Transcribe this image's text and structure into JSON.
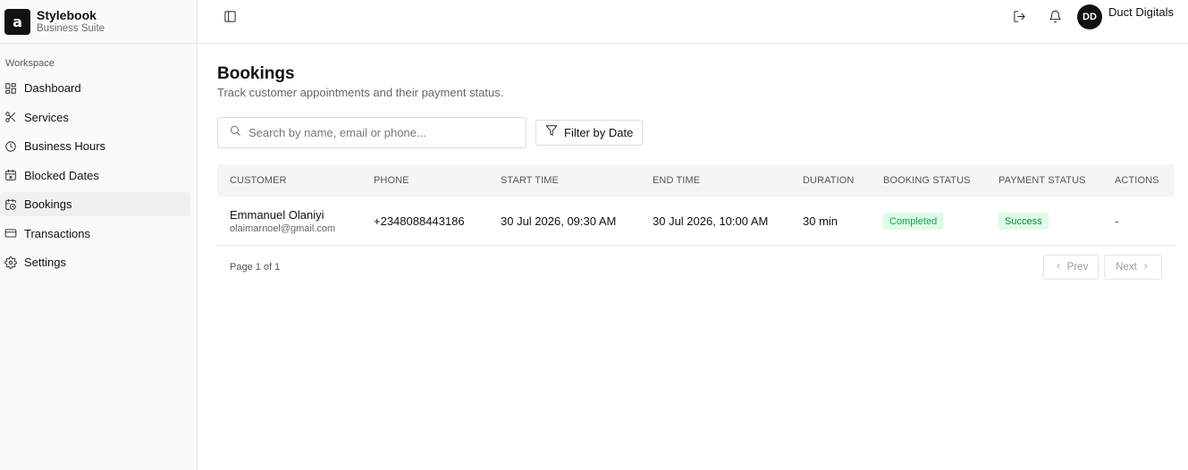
{
  "brand": {
    "logo": "a",
    "name": "Stylebook",
    "subtitle": "Business Suite"
  },
  "sidebar": {
    "group_label": "Workspace",
    "items": [
      {
        "label": "Dashboard",
        "icon": "dashboard-icon",
        "active": false
      },
      {
        "label": "Services",
        "icon": "scissors-icon",
        "active": false
      },
      {
        "label": "Business Hours",
        "icon": "clock-icon",
        "active": false
      },
      {
        "label": "Blocked Dates",
        "icon": "calendar-x-icon",
        "active": false
      },
      {
        "label": "Bookings",
        "icon": "calendar-clock-icon",
        "active": true
      },
      {
        "label": "Transactions",
        "icon": "credit-card-icon",
        "active": false
      },
      {
        "label": "Settings",
        "icon": "gear-icon",
        "active": false
      }
    ]
  },
  "topbar": {
    "avatar_initials": "DD",
    "user_name": "Duct Digitals"
  },
  "page": {
    "title": "Bookings",
    "subtitle": "Track customer appointments and their payment status.",
    "search_placeholder": "Search by name, email or phone...",
    "filter_label": "Filter by Date"
  },
  "table": {
    "headers": [
      "Customer",
      "Phone",
      "Start Time",
      "End Time",
      "Duration",
      "Booking Status",
      "Payment Status",
      "Actions"
    ],
    "rows": [
      {
        "name": "Emmanuel Olaniyi",
        "email": "olaimarnoel@gmail.com",
        "phone": "+2348088443186",
        "start": "30 Jul 2026, 09:30 AM",
        "end": "30 Jul 2026, 10:00 AM",
        "duration": "30 min",
        "booking_status": "Completed",
        "payment_status": "Success",
        "actions": "-"
      }
    ]
  },
  "pagination": {
    "text": "Page 1 of 1",
    "prev": "Prev",
    "next": "Next"
  },
  "colors": {
    "status_green_bg": "#dcfce7",
    "status_green_text": "#16a34a",
    "dark": "#111111"
  }
}
